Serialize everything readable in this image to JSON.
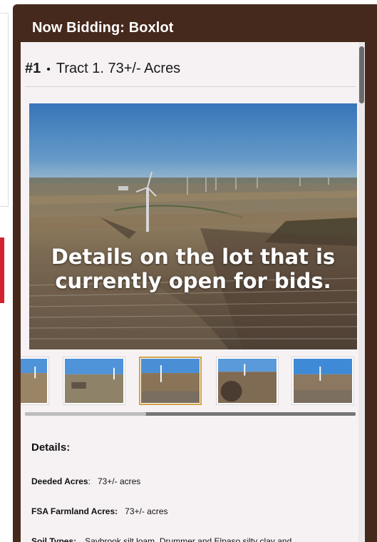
{
  "panel": {
    "title": "Now Bidding: Boxlot"
  },
  "lot": {
    "number": "#1",
    "separator": "•",
    "title": "Tract 1. 73+/- Acres"
  },
  "hero": {
    "caption": "Details on the lot that is currently open for bids."
  },
  "thumbnails": {
    "count": 5,
    "active_index": 2,
    "scroll_position_fraction": 0.36
  },
  "details": {
    "title": "Details:",
    "rows": [
      {
        "label": "Deeded Acres",
        "label_suffix": ":",
        "value": "73+/- acres"
      },
      {
        "label": "FSA Farmland Acres:",
        "label_suffix": "",
        "value": "73+/- acres"
      },
      {
        "label": "Soil Types:",
        "label_suffix": "",
        "value": "Saybrook silt loam, Drummer and Elpaso silty clay and"
      }
    ]
  },
  "colors": {
    "panel_bg": "#46291d",
    "content_bg": "#f6f2f4",
    "accent_red": "#d2232f",
    "active_thumb_border": "#d4a24a"
  }
}
